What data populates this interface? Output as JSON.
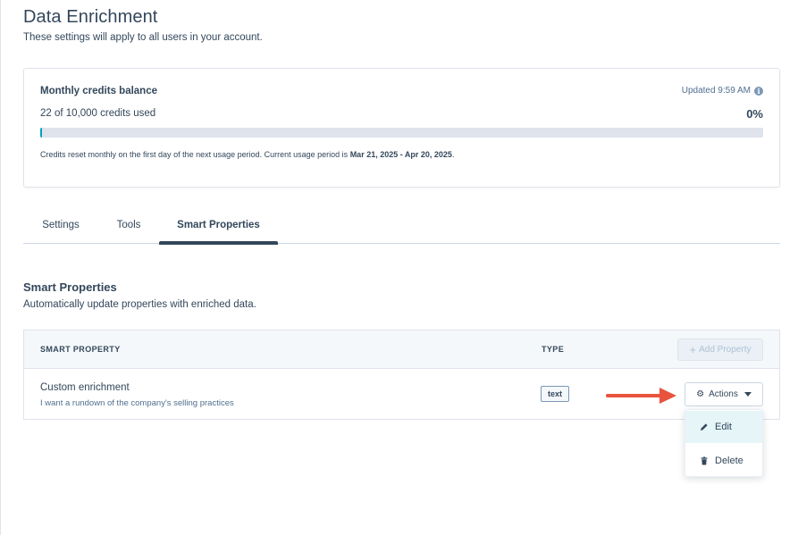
{
  "page": {
    "title": "Data Enrichment",
    "subtitle": "These settings will apply to all users in your account."
  },
  "credits": {
    "title": "Monthly credits balance",
    "updated": "Updated 9:59 AM",
    "used_text": "22 of 10,000 credits used",
    "percent_text": "0%",
    "used": 22,
    "total": 10000,
    "progress_fraction": 0.0022,
    "note_prefix": "Credits reset monthly on the first day of the next usage period. Current usage period is ",
    "period": "Mar 21, 2025 - Apr 20, 2025",
    "note_suffix": ".",
    "accent_color": "#00a4bd"
  },
  "tabs": [
    {
      "label": "Settings",
      "active": false
    },
    {
      "label": "Tools",
      "active": false
    },
    {
      "label": "Smart Properties",
      "active": true
    }
  ],
  "section": {
    "title": "Smart Properties",
    "description": "Automatically update properties with enriched data."
  },
  "table": {
    "headers": {
      "property": "SMART PROPERTY",
      "type": "TYPE"
    },
    "add_button": "Add Property",
    "rows": [
      {
        "name": "Custom enrichment",
        "description": "I want a rundown of the company's selling practices",
        "type": "text",
        "actions_label": "Actions"
      }
    ]
  },
  "actions_menu": {
    "items": [
      {
        "label": "Edit",
        "icon": "pencil-icon"
      },
      {
        "label": "Delete",
        "icon": "trash-icon"
      }
    ]
  },
  "annotation": {
    "arrow_color": "#e8533e"
  }
}
